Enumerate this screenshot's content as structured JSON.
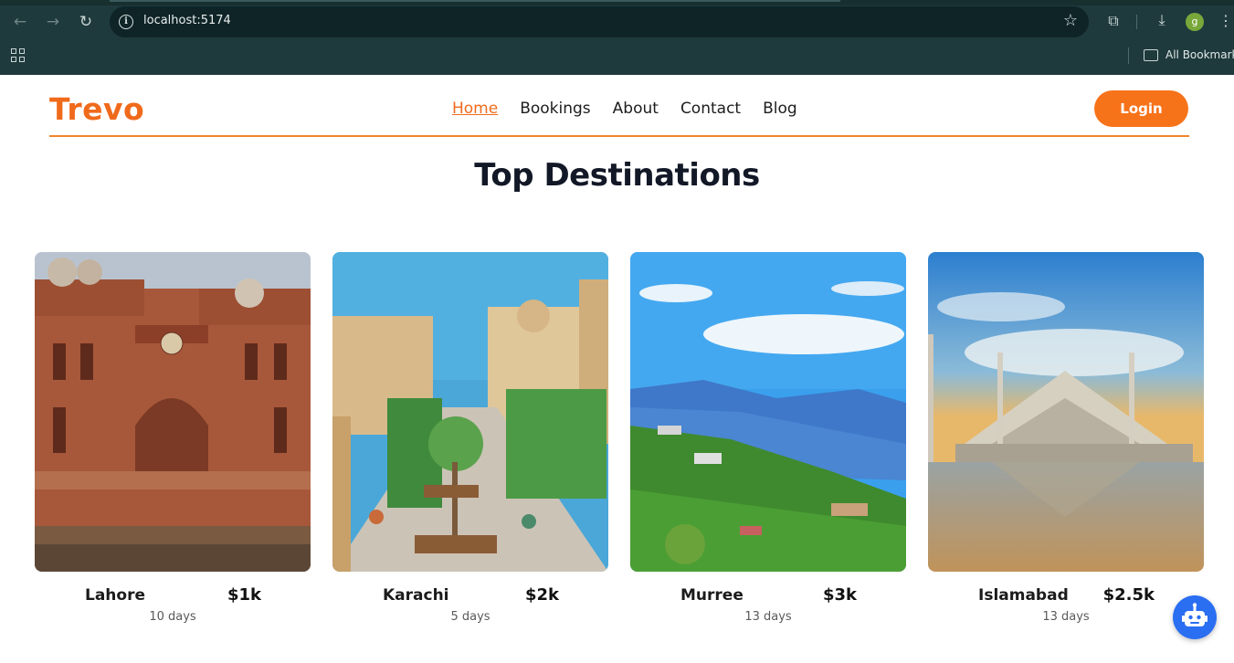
{
  "browser": {
    "url": "localhost:5174",
    "profile_initial": "g",
    "bookmarks_label": "All Bookmarks"
  },
  "header": {
    "brand": "Trevo",
    "nav": [
      "Home",
      "Bookings",
      "About",
      "Contact",
      "Blog"
    ],
    "active_nav": "Home",
    "login_label": "Login"
  },
  "section": {
    "title": "Top Destinations"
  },
  "destinations": [
    {
      "city": "Lahore",
      "price": "$1k",
      "duration": "10 days"
    },
    {
      "city": "Karachi",
      "price": "$2k",
      "duration": "5 days"
    },
    {
      "city": "Murree",
      "price": "$3k",
      "duration": "13 days"
    },
    {
      "city": "Islamabad",
      "price": "$2.5k",
      "duration": "13 days"
    }
  ],
  "colors": {
    "brand": "#f06a1c",
    "login_button": "#f7731a",
    "chat_button": "#2a6ef2",
    "chrome": "#1f3a3d"
  }
}
